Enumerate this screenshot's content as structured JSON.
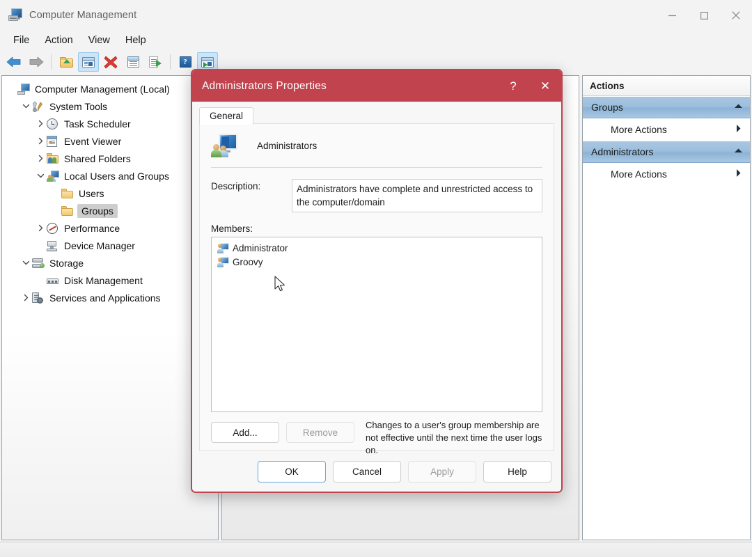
{
  "window": {
    "title": "Computer Management",
    "icon": "computer-management-icon",
    "controls": {
      "minimize": "–",
      "maximize": "☐",
      "close": "✕"
    }
  },
  "menubar": {
    "items": [
      "File",
      "Action",
      "View",
      "Help"
    ]
  },
  "toolbar": {
    "items": [
      {
        "name": "back-arrow-icon",
        "label": "Back"
      },
      {
        "name": "forward-arrow-icon",
        "label": "Forward"
      },
      {
        "name": "up-one-level-icon",
        "label": "Up One Level"
      },
      {
        "name": "show-hide-console-tree-icon",
        "label": "Show/Hide Console Tree"
      },
      {
        "name": "delete-icon",
        "label": "Delete"
      },
      {
        "name": "properties-icon",
        "label": "Properties"
      },
      {
        "name": "export-list-icon",
        "label": "Export List"
      },
      {
        "name": "help-icon",
        "label": "Help"
      },
      {
        "name": "show-action-pane-icon",
        "label": "Show/Hide Action Pane"
      }
    ]
  },
  "tree": {
    "items": [
      {
        "label": "Computer Management (Local)",
        "icon": "mmc-icon",
        "indent": 0,
        "twisty": "",
        "selected": false
      },
      {
        "label": "System Tools",
        "icon": "tools-icon",
        "indent": 1,
        "twisty": "expanded",
        "selected": false
      },
      {
        "label": "Task Scheduler",
        "icon": "clock-icon",
        "indent": 2,
        "twisty": "collapsed",
        "selected": false
      },
      {
        "label": "Event Viewer",
        "icon": "event-viewer-icon",
        "indent": 2,
        "twisty": "collapsed",
        "selected": false
      },
      {
        "label": "Shared Folders",
        "icon": "shared-folders-icon",
        "indent": 2,
        "twisty": "collapsed",
        "selected": false
      },
      {
        "label": "Local Users and Groups",
        "icon": "local-users-groups-icon",
        "indent": 2,
        "twisty": "expanded",
        "selected": false
      },
      {
        "label": "Users",
        "icon": "folder-icon",
        "indent": 3,
        "twisty": "",
        "selected": false
      },
      {
        "label": "Groups",
        "icon": "folder-icon",
        "indent": 3,
        "twisty": "",
        "selected": true
      },
      {
        "label": "Performance",
        "icon": "performance-icon",
        "indent": 2,
        "twisty": "collapsed",
        "selected": false
      },
      {
        "label": "Device Manager",
        "icon": "device-manager-icon",
        "indent": 2,
        "twisty": "",
        "selected": false
      },
      {
        "label": "Storage",
        "icon": "storage-icon",
        "indent": 1,
        "twisty": "expanded",
        "selected": false
      },
      {
        "label": "Disk Management",
        "icon": "disk-management-icon",
        "indent": 2,
        "twisty": "",
        "selected": false
      },
      {
        "label": "Services and Applications",
        "icon": "services-applications-icon",
        "indent": 1,
        "twisty": "collapsed",
        "selected": false
      }
    ]
  },
  "actions": {
    "header": "Actions",
    "groups": [
      {
        "title": "Groups",
        "items": [
          {
            "label": "More Actions",
            "submenu": true
          }
        ]
      },
      {
        "title": "Administrators",
        "items": [
          {
            "label": "More Actions",
            "submenu": true
          }
        ]
      }
    ]
  },
  "dialog": {
    "title": "Administrators Properties",
    "help_button": "?",
    "close_button": "✕",
    "tabs": [
      {
        "label": "General",
        "active": true
      }
    ],
    "group_name": "Administrators",
    "group_icon": "group-icon",
    "description_label": "Description:",
    "description_value": "Administrators have complete and unrestricted access to the computer/domain",
    "members_label": "Members:",
    "members": [
      {
        "name": "Administrator",
        "icon": "user-icon"
      },
      {
        "name": "Groovy",
        "icon": "user-icon"
      }
    ],
    "add_button": "Add...",
    "remove_button": "Remove",
    "remove_disabled": true,
    "note": "Changes to a user's group membership are not effective until the next time the user logs on.",
    "footer_buttons": [
      {
        "label": "OK",
        "default": true,
        "disabled": false
      },
      {
        "label": "Cancel",
        "default": false,
        "disabled": false
      },
      {
        "label": "Apply",
        "default": false,
        "disabled": true
      },
      {
        "label": "Help",
        "default": false,
        "disabled": false
      }
    ]
  },
  "colors": {
    "dialog_accent": "#c0434e",
    "actions_group_bar": "#9dbfdd",
    "window_background": "#f3f3f3",
    "selection": "#cdcdcd"
  },
  "statusbar": {
    "segments": [
      "",
      "",
      ""
    ]
  }
}
